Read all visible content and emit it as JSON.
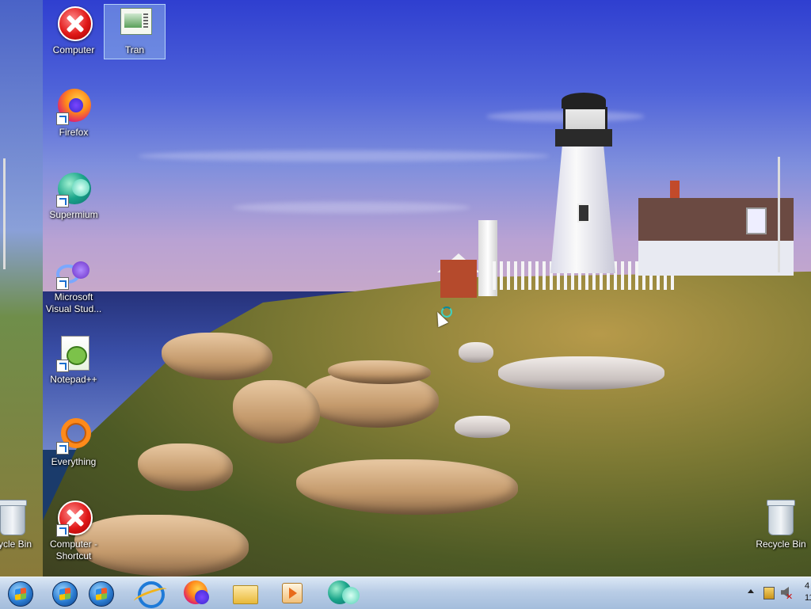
{
  "desktop": {
    "icons_left": [
      {
        "label": "Computer",
        "icon": "error-icon"
      },
      {
        "label": "Firefox",
        "icon": "firefox-icon"
      },
      {
        "label": "Supermium",
        "icon": "supermium-icon"
      },
      {
        "label": "Microsoft Visual Stud...",
        "icon": "visual-studio-icon"
      },
      {
        "label": "Notepad++",
        "icon": "notepad-plus-plus-icon"
      },
      {
        "label": "Everything",
        "icon": "everything-search-icon"
      },
      {
        "label": "Computer - Shortcut",
        "icon": "error-icon"
      }
    ],
    "icon_tran": {
      "label": "Tran",
      "icon": "document-thumbnail-icon",
      "selected": true
    },
    "recycle_bin_left": {
      "label": "cycle Bin",
      "icon": "recycle-bin-icon"
    },
    "recycle_bin_right": {
      "label": "Recycle Bin",
      "icon": "recycle-bin-icon"
    }
  },
  "taskbar": {
    "items": [
      {
        "name": "start-orb",
        "icon": "windows-orb-icon"
      },
      {
        "name": "windows-orb-2",
        "icon": "windows-orb-icon"
      },
      {
        "name": "windows-orb-3",
        "icon": "windows-orb-icon"
      },
      {
        "name": "internet-explorer",
        "icon": "internet-explorer-icon"
      },
      {
        "name": "firefox",
        "icon": "firefox-icon"
      },
      {
        "name": "file-explorer",
        "icon": "folder-icon"
      },
      {
        "name": "media-player",
        "icon": "media-player-icon"
      },
      {
        "name": "supermium",
        "icon": "supermium-icon"
      }
    ],
    "tray": {
      "icons": [
        "show-hidden-icons-arrow",
        "action-center-flag-icon",
        "volume-muted-icon"
      ],
      "clock_time": "4",
      "clock_date": "11"
    }
  },
  "colors": {
    "taskbar_top": "#dbe7f5",
    "taskbar_bottom": "#a4bddc",
    "selection": "#a0c8f0"
  }
}
